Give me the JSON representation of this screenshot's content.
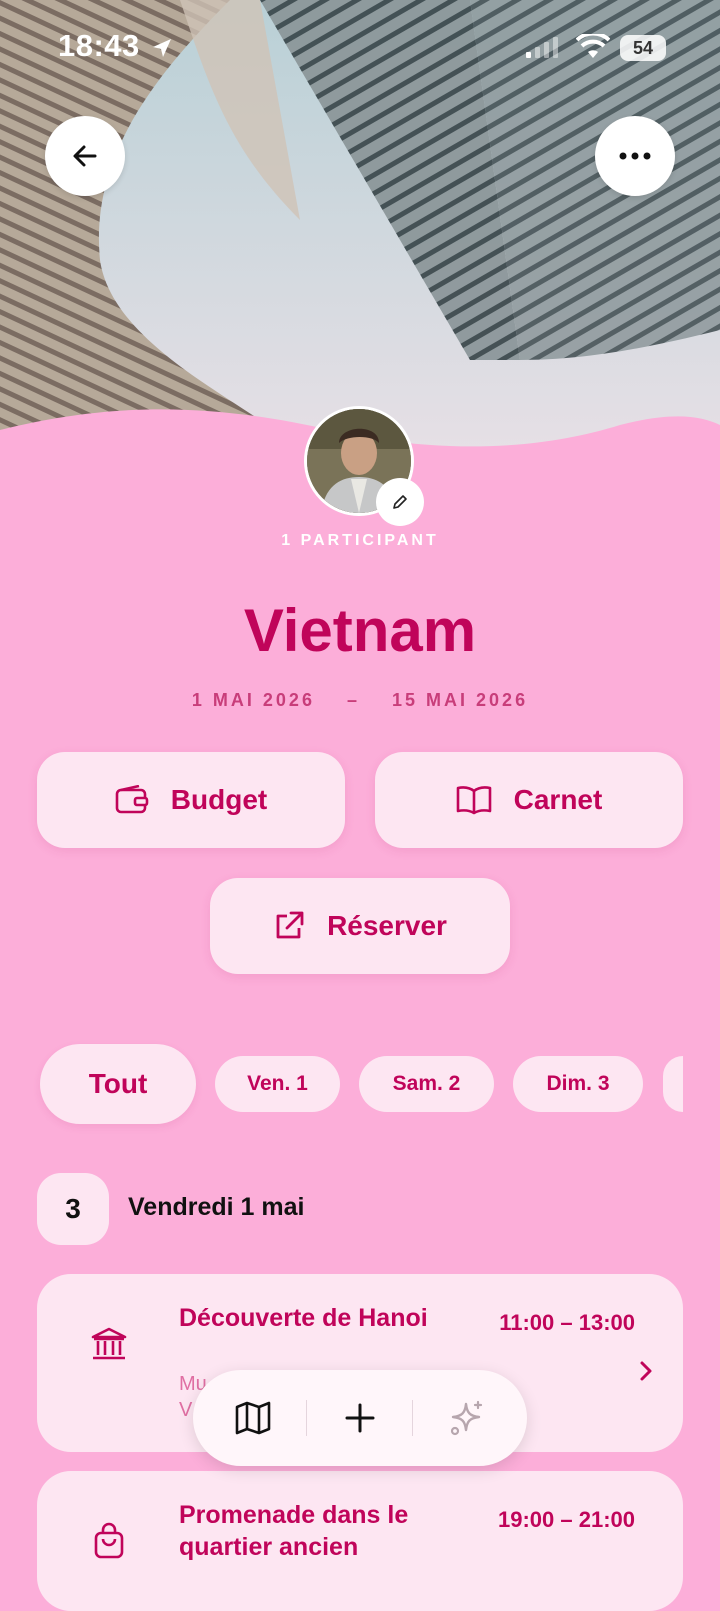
{
  "status_bar": {
    "time": "18:43",
    "battery": "54"
  },
  "trip": {
    "participants": "1 PARTICIPANT",
    "title": "Vietnam",
    "date_start": "1 MAI 2026",
    "date_separator": "–",
    "date_end": "15 MAI 2026"
  },
  "actions": {
    "budget": "Budget",
    "carnet": "Carnet",
    "reserver": "Réserver"
  },
  "filters": [
    {
      "label": "Tout"
    },
    {
      "label": "Ven. 1"
    },
    {
      "label": "Sam. 2"
    },
    {
      "label": "Dim. 3"
    }
  ],
  "day": {
    "count": "3",
    "label": "Vendredi 1 mai"
  },
  "activities": [
    {
      "title": "Découverte de Hanoi",
      "time": "11:00 – 13:00",
      "sub1": "Mu",
      "sub2": "V",
      "icon": "museum-icon"
    },
    {
      "title": "Promenade dans le quartier ancien",
      "time": "19:00 – 21:00",
      "icon": "shopping-bag-icon"
    }
  ],
  "colors": {
    "accent": "#c0045a",
    "background": "#fcaed9",
    "surface": "#fde6f2"
  }
}
